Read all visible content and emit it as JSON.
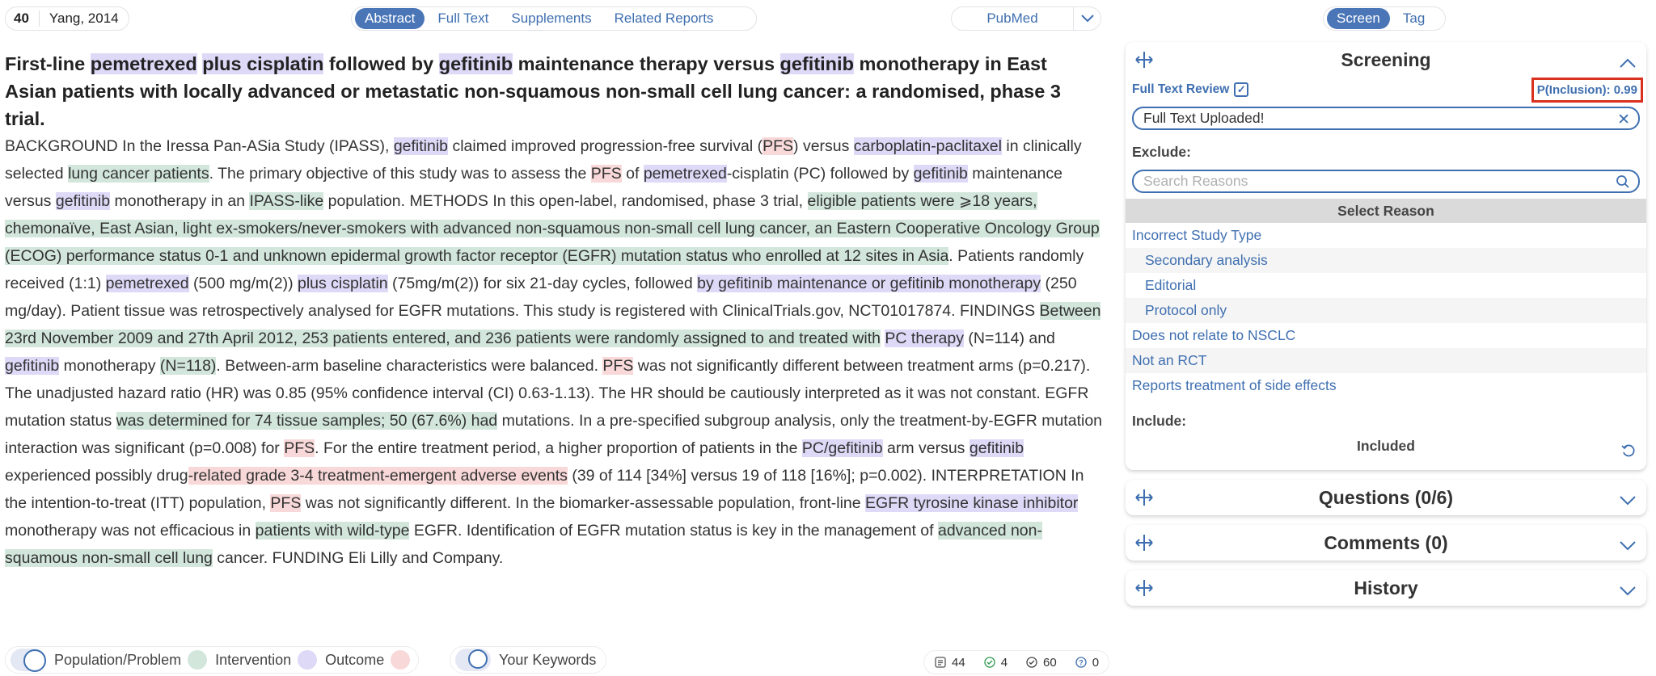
{
  "topbar": {
    "ref_number": "40",
    "ref_author": "Yang, 2014",
    "tabs": [
      "Abstract",
      "Full Text",
      "Supplements",
      "Related Reports"
    ],
    "pubmed_label": "PubMed",
    "mode_tabs": [
      "Screen",
      "Tag"
    ]
  },
  "article": {
    "title_segments": [
      {
        "text": "First-line ",
        "h": ""
      },
      {
        "text": "pemetrexed",
        "h": "i"
      },
      {
        "text": " ",
        "h": ""
      },
      {
        "text": "plus cisplatin",
        "h": "i"
      },
      {
        "text": " followed by ",
        "h": ""
      },
      {
        "text": "gefitinib",
        "h": "i"
      },
      {
        "text": " maintenance therapy versus ",
        "h": ""
      },
      {
        "text": "gefitinib",
        "h": "i"
      },
      {
        "text": " monotherapy in East Asian patients with locally advanced or metastatic non-squamous non-small cell lung cancer: a randomised, phase 3 trial.",
        "h": ""
      }
    ],
    "abstract_segments": [
      {
        "text": "BACKGROUND In the Iressa Pan-ASia Study (IPASS), ",
        "h": ""
      },
      {
        "text": "gefitinib",
        "h": "i"
      },
      {
        "text": " claimed improved progression-free survival (",
        "h": ""
      },
      {
        "text": "PFS",
        "h": "o"
      },
      {
        "text": ") versus ",
        "h": ""
      },
      {
        "text": "carboplatin-paclitaxel",
        "h": "i"
      },
      {
        "text": " in clinically selected ",
        "h": ""
      },
      {
        "text": "lung cancer patients",
        "h": "p"
      },
      {
        "text": ". The primary objective of this study was to assess the ",
        "h": ""
      },
      {
        "text": "PFS",
        "h": "o"
      },
      {
        "text": " of ",
        "h": ""
      },
      {
        "text": "pemetrexed",
        "h": "i"
      },
      {
        "text": "-cisplatin (PC) followed by ",
        "h": ""
      },
      {
        "text": "gefitinib",
        "h": "i"
      },
      {
        "text": " maintenance versus ",
        "h": ""
      },
      {
        "text": "gefitinib",
        "h": "i"
      },
      {
        "text": " monotherapy in an ",
        "h": ""
      },
      {
        "text": "IPASS-like",
        "h": "p"
      },
      {
        "text": " population. METHODS In this open-label, randomised, phase 3 trial, ",
        "h": ""
      },
      {
        "text": "eligible patients were ⩾18 years, chemonaïve, East Asian, light ex-smokers/never-smokers with advanced non-squamous non-small cell lung cancer, an Eastern Cooperative Oncology Group (ECOG) performance status 0-1 and unknown epidermal growth factor receptor (EGFR) mutation status who enrolled at 12 sites in Asia",
        "h": "p"
      },
      {
        "text": ". Patients randomly received (1:1) ",
        "h": ""
      },
      {
        "text": "pemetrexed",
        "h": "i"
      },
      {
        "text": " (500 mg/m(2)) ",
        "h": ""
      },
      {
        "text": "plus cisplatin",
        "h": "i"
      },
      {
        "text": " (75mg/m(2)) for six 21-day cycles, followed ",
        "h": ""
      },
      {
        "text": "by gefitinib maintenance or gefitinib monotherapy",
        "h": "i"
      },
      {
        "text": " (250 mg/day). Patient tissue was retrospectively analysed for EGFR mutations. This study is registered with ClinicalTrials.gov, NCT01017874. FINDINGS ",
        "h": ""
      },
      {
        "text": "Between 23rd November 2009 and 27th April 2012, 253 patients entered, and 236 patients were randomly assigned to and treated with",
        "h": "p"
      },
      {
        "text": " ",
        "h": ""
      },
      {
        "text": "PC therapy",
        "h": "i"
      },
      {
        "text": " (N=114) and ",
        "h": ""
      },
      {
        "text": "gefitinib",
        "h": "i"
      },
      {
        "text": " monotherapy ",
        "h": ""
      },
      {
        "text": "(N=118)",
        "h": "p"
      },
      {
        "text": ". Between-arm baseline characteristics were balanced. ",
        "h": ""
      },
      {
        "text": "PFS",
        "h": "o"
      },
      {
        "text": " was not significantly different between treatment arms (p=0.217). The unadjusted hazard ratio (HR) was 0.85 (95% confidence interval (CI) 0.63-1.13). The HR should be cautiously interpreted as it was not constant. EGFR mutation status ",
        "h": ""
      },
      {
        "text": "was determined for 74 tissue samples; 50 (67.6%) had",
        "h": "p"
      },
      {
        "text": " mutations. In a pre-specified subgroup analysis, only the treatment-by-EGFR mutation interaction was significant (p=0.008) for ",
        "h": ""
      },
      {
        "text": "PFS",
        "h": "o"
      },
      {
        "text": ". For the entire treatment period, a higher proportion of patients in the ",
        "h": ""
      },
      {
        "text": "PC/gefitinib",
        "h": "i"
      },
      {
        "text": " arm versus ",
        "h": ""
      },
      {
        "text": "gefitinib",
        "h": "i"
      },
      {
        "text": " experienced possibly drug",
        "h": ""
      },
      {
        "text": "-related grade 3-4 treatment-emergent adverse events",
        "h": "o"
      },
      {
        "text": " (39 of 114 [34%] versus 19 of 118 [16%]; p=0.002). INTERPRETATION In the intention-to-treat (ITT) population, ",
        "h": ""
      },
      {
        "text": "PFS",
        "h": "o"
      },
      {
        "text": " was not significantly different. In the biomarker-assessable population, front-line ",
        "h": ""
      },
      {
        "text": "EGFR tyrosine kinase inhibitor",
        "h": "i"
      },
      {
        "text": " monotherapy was not efficacious in ",
        "h": ""
      },
      {
        "text": "patients with wild-type",
        "h": "p"
      },
      {
        "text": " EGFR. Identification of EGFR mutation status is key in the management of ",
        "h": ""
      },
      {
        "text": "advanced non-squamous non-small cell lung",
        "h": "p"
      },
      {
        "text": " cancer. FUNDING Eli Lilly and Company.",
        "h": ""
      }
    ]
  },
  "legend": {
    "population": "Population/Problem",
    "intervention": "Intervention",
    "outcome": "Outcome",
    "keywords": "Your Keywords",
    "colors": {
      "population": "#d2e6dc",
      "intervention": "#ddd9f7",
      "outcome": "#f8d8d8"
    }
  },
  "stats": {
    "total": "44",
    "included": "4",
    "excluded": "60",
    "unknown": "0"
  },
  "screening": {
    "header": "Screening",
    "full_text_review": "Full Text Review",
    "p_inclusion": "P(Inclusion): 0.99",
    "full_text_status": "Full Text Uploaded!",
    "exclude_label": "Exclude:",
    "search_placeholder": "Search Reasons",
    "select_reason": "Select Reason",
    "reasons": [
      {
        "label": "Incorrect Study Type",
        "sub": false
      },
      {
        "label": "Secondary analysis",
        "sub": true
      },
      {
        "label": "Editorial",
        "sub": true
      },
      {
        "label": "Protocol only",
        "sub": true
      },
      {
        "label": "Does not relate to NSCLC",
        "sub": false
      },
      {
        "label": "Not an RCT",
        "sub": false
      },
      {
        "label": "Reports treatment of side effects",
        "sub": false
      }
    ],
    "include_label": "Include:",
    "included_value": "Included"
  },
  "sections": {
    "questions": "Questions (0/6)",
    "comments": "Comments (0)",
    "history": "History"
  },
  "colors": {
    "accent": "#3f6fb0",
    "highlight_box": "#d9301f"
  }
}
